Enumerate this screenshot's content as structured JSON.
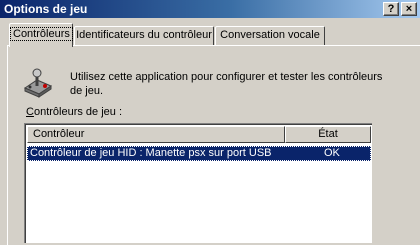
{
  "window": {
    "title": "Options de jeu",
    "help_button": "?",
    "close_button": "×"
  },
  "tabs": [
    {
      "label": "Contrôleurs",
      "selected": true
    },
    {
      "label": "Identificateurs du contrôleur",
      "selected": false
    },
    {
      "label": "Conversation vocale",
      "selected": false
    }
  ],
  "panel": {
    "icon": "joystick-icon",
    "description": "Utilisez cette application pour configurer et tester les contrôleurs de jeu.",
    "list_label_accel": "C",
    "list_label_rest": "ontrôleurs de jeu :"
  },
  "list": {
    "columns": [
      "Contrôleur",
      "État"
    ],
    "rows": [
      {
        "controller": "Contrôleur de jeu HID : Manette psx sur port USB",
        "state": "OK",
        "selected": true
      }
    ]
  },
  "colors": {
    "titlebar_start": "#0a246a",
    "titlebar_end": "#a6caf0",
    "selection": "#0a246a",
    "face": "#d4d0c8"
  }
}
